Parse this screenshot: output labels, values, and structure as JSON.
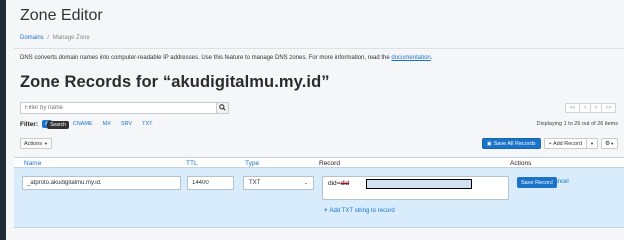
{
  "page": {
    "title": "Zone Editor",
    "breadcrumb": [
      "Domains",
      "Manage Zone"
    ],
    "breadcrumb_sep": "/",
    "intro_text": "DNS converts domain names into computer-readable IP addresses. Use this feature to manage DNS zones. For more information, read the ",
    "intro_link": "documentation",
    "intro_end": "."
  },
  "records": {
    "title": "Zone Records for “akudigitalmu.my.id”",
    "filter_placeholder": "Filter by name",
    "filter_label": "Filter:",
    "tooltip": "Search",
    "filter_options": [
      "CNAME",
      "MX",
      "SRV",
      "TXT"
    ],
    "pager": [
      "<<",
      "<",
      ">",
      ">>"
    ],
    "displaying": "Displaying 1 to 26 out of 26 items",
    "actions_label": "Actions",
    "save_all_label": "Save All Records",
    "add_record_label": "+ Add Record"
  },
  "table": {
    "headers": {
      "name": "Name",
      "ttl": "TTL",
      "type": "Type",
      "record": "Record",
      "actions": "Actions"
    },
    "row": {
      "name": "_atproto.akudigitalmu.my.id.",
      "ttl": "14400",
      "type": "TXT",
      "record_prefix": "did=",
      "record_prefix_struck": "did",
      "save_label": "Save Record",
      "cancel_label": "Cancel",
      "add_txt_label": "Add TXT string to record"
    }
  },
  "colors": {
    "accent": "#1a73c8",
    "row_bg": "#d9ecfb"
  }
}
